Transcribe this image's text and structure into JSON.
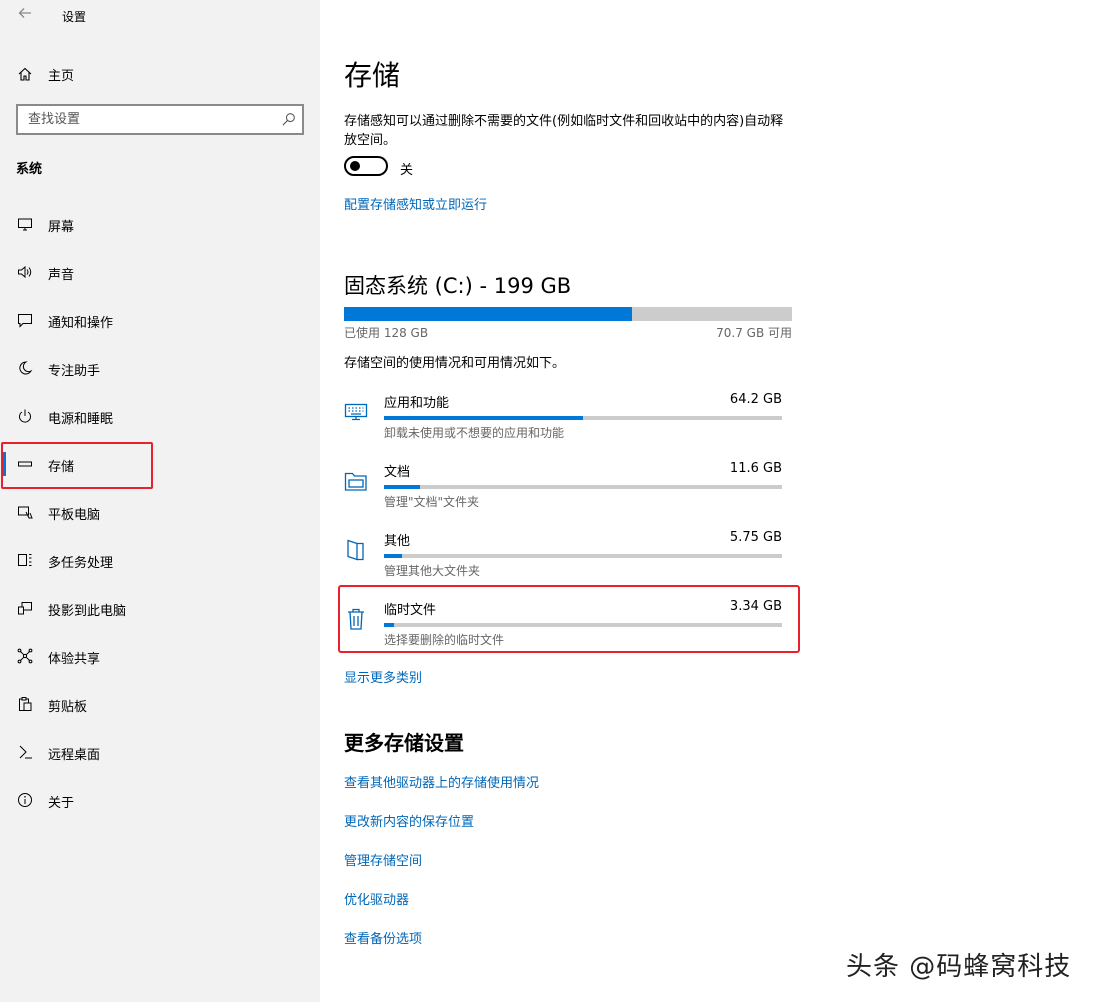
{
  "window": {
    "title": "设置",
    "back_icon": "back-arrow-icon"
  },
  "sidebar": {
    "home": {
      "label": "主页",
      "icon": "home-icon"
    },
    "search": {
      "placeholder": "查找设置",
      "icon": "search-icon"
    },
    "section": "系统",
    "items": [
      {
        "label": "屏幕",
        "icon": "display-icon"
      },
      {
        "label": "声音",
        "icon": "speaker-icon"
      },
      {
        "label": "通知和操作",
        "icon": "notification-icon"
      },
      {
        "label": "专注助手",
        "icon": "moon-icon"
      },
      {
        "label": "电源和睡眠",
        "icon": "power-icon"
      },
      {
        "label": "存储",
        "icon": "storage-icon",
        "selected": true
      },
      {
        "label": "平板电脑",
        "icon": "tablet-icon"
      },
      {
        "label": "多任务处理",
        "icon": "multitask-icon"
      },
      {
        "label": "投影到此电脑",
        "icon": "project-icon"
      },
      {
        "label": "体验共享",
        "icon": "share-icon"
      },
      {
        "label": "剪贴板",
        "icon": "clipboard-icon"
      },
      {
        "label": "远程桌面",
        "icon": "remote-icon"
      },
      {
        "label": "关于",
        "icon": "info-icon"
      }
    ]
  },
  "main": {
    "title": "存储",
    "description": "存储感知可以通过删除不需要的文件(例如临时文件和回收站中的内容)自动释放空间。",
    "toggle": {
      "state_label": "关",
      "on": false
    },
    "configure_link": "配置存储感知或立即运行",
    "drive": {
      "title": "固态系统 (C:) - 199 GB",
      "used_label": "已使用 128 GB",
      "free_label": "70.7 GB 可用",
      "used_fraction": 0.643,
      "intro": "存储空间的使用情况和可用情况如下。"
    },
    "categories": [
      {
        "name": "应用和功能",
        "size": "64.2 GB",
        "sub": "卸载未使用或不想要的应用和功能",
        "fraction": 0.5,
        "icon": "keyboard-icon"
      },
      {
        "name": "文档",
        "size": "11.6 GB",
        "sub": "管理\"文档\"文件夹",
        "fraction": 0.09,
        "icon": "folder-icon"
      },
      {
        "name": "其他",
        "size": "5.75 GB",
        "sub": "管理其他大文件夹",
        "fraction": 0.045,
        "icon": "file-icon"
      },
      {
        "name": "临时文件",
        "size": "3.34 GB",
        "sub": "选择要删除的临时文件",
        "fraction": 0.025,
        "icon": "trash-icon"
      }
    ],
    "show_more_link": "显示更多类别",
    "more_title": "更多存储设置",
    "more_links": [
      "查看其他驱动器上的存储使用情况",
      "更改新内容的保存位置",
      "管理存储空间",
      "优化驱动器",
      "查看备份选项"
    ]
  },
  "watermark": "头条 @码蜂窝科技",
  "colors": {
    "accent": "#0078d7",
    "link": "#0067b8",
    "highlight": "#e8212d",
    "sidebar_bg": "#f2f2f2"
  }
}
